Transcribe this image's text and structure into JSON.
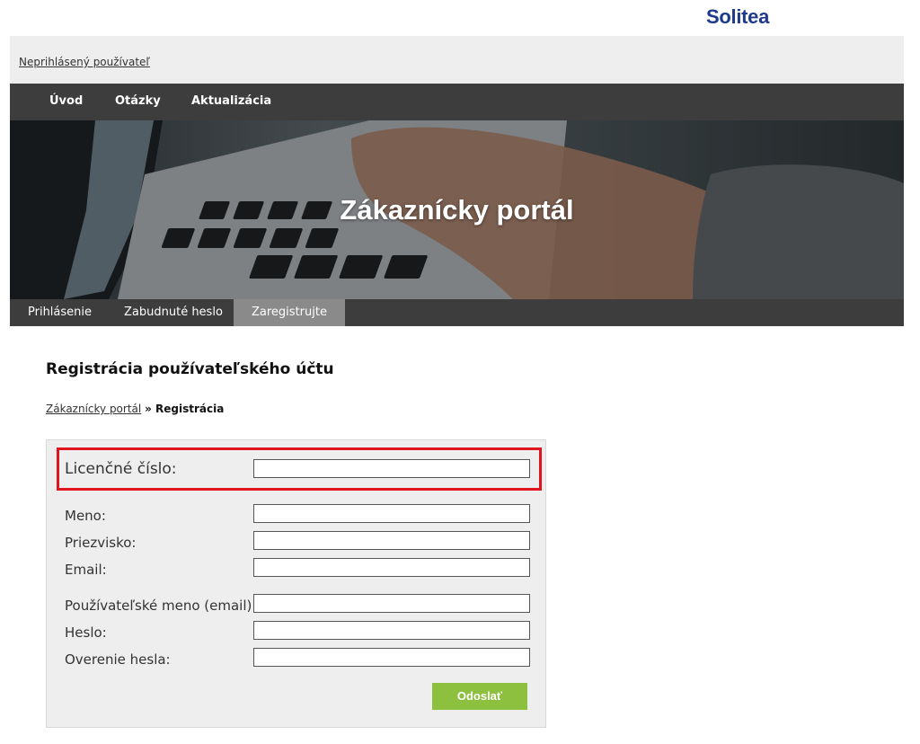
{
  "brand": {
    "logo_text": "Solitea",
    "color": "#1f3a8a"
  },
  "userbar": {
    "status_link": "Neprihlásený používateľ"
  },
  "main_nav": {
    "items": [
      {
        "label": "Úvod"
      },
      {
        "label": "Otázky"
      },
      {
        "label": "Aktualizácia"
      }
    ]
  },
  "hero": {
    "title": "Zákaznícky portál"
  },
  "sub_nav": {
    "tabs": [
      {
        "label": "Prihlásenie",
        "active": false
      },
      {
        "label": "Zabudnuté heslo",
        "active": false
      },
      {
        "label": "Zaregistrujte",
        "active": true
      }
    ]
  },
  "page": {
    "heading": "Registrácia používateľského účtu",
    "breadcrumb": {
      "link": "Zákaznícky portál",
      "separator": "»",
      "current": "Registrácia"
    }
  },
  "form": {
    "license": {
      "label": "Licenčné číslo:",
      "value": ""
    },
    "first_name": {
      "label": "Meno:",
      "value": ""
    },
    "last_name": {
      "label": "Priezvisko:",
      "value": ""
    },
    "email": {
      "label": "Email:",
      "value": ""
    },
    "username": {
      "label": "Používateľské meno (email):",
      "value": ""
    },
    "password": {
      "label": "Heslo:",
      "value": ""
    },
    "password_confirm": {
      "label": "Overenie hesla:",
      "value": ""
    },
    "submit_label": "Odoslať",
    "highlight_color": "#e0141e",
    "submit_color": "#8dc03f"
  }
}
